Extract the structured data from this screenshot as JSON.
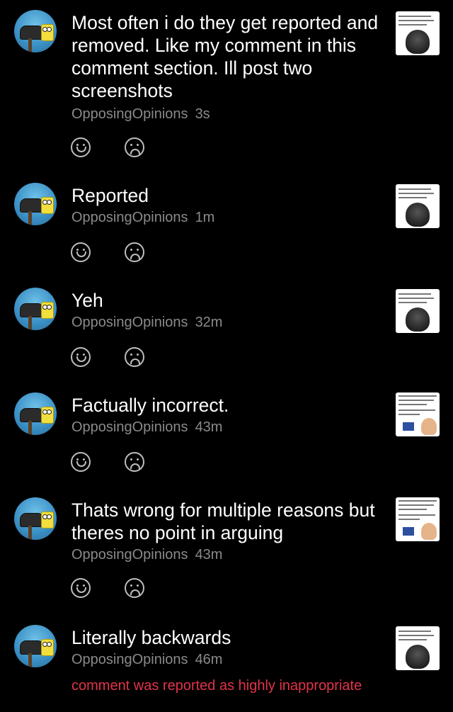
{
  "notifications": [
    {
      "text": "Most often i do they get reported and removed. Like my comment in this comment section. Ill post two screenshots",
      "user": "OpposingOpinions",
      "time": "3s",
      "thumb": "skull"
    },
    {
      "text": "Reported",
      "user": "OpposingOpinions",
      "time": "1m",
      "thumb": "skull"
    },
    {
      "text": "Yeh",
      "user": "OpposingOpinions",
      "time": "32m",
      "thumb": "skull"
    },
    {
      "text": "Factually incorrect.",
      "user": "OpposingOpinions",
      "time": "43m",
      "thumb": "map"
    },
    {
      "text": "Thats wrong for multiple reasons but theres no point in arguing",
      "user": "OpposingOpinions",
      "time": "43m",
      "thumb": "map"
    },
    {
      "text": "Literally backwards",
      "user": "OpposingOpinions",
      "time": "46m",
      "thumb": "skull"
    }
  ],
  "footer": {
    "status": "comment was reported as highly inappropriate"
  },
  "colors": {
    "meta": "#8a8a8a",
    "alert": "#e2334a",
    "background": "#000000"
  }
}
